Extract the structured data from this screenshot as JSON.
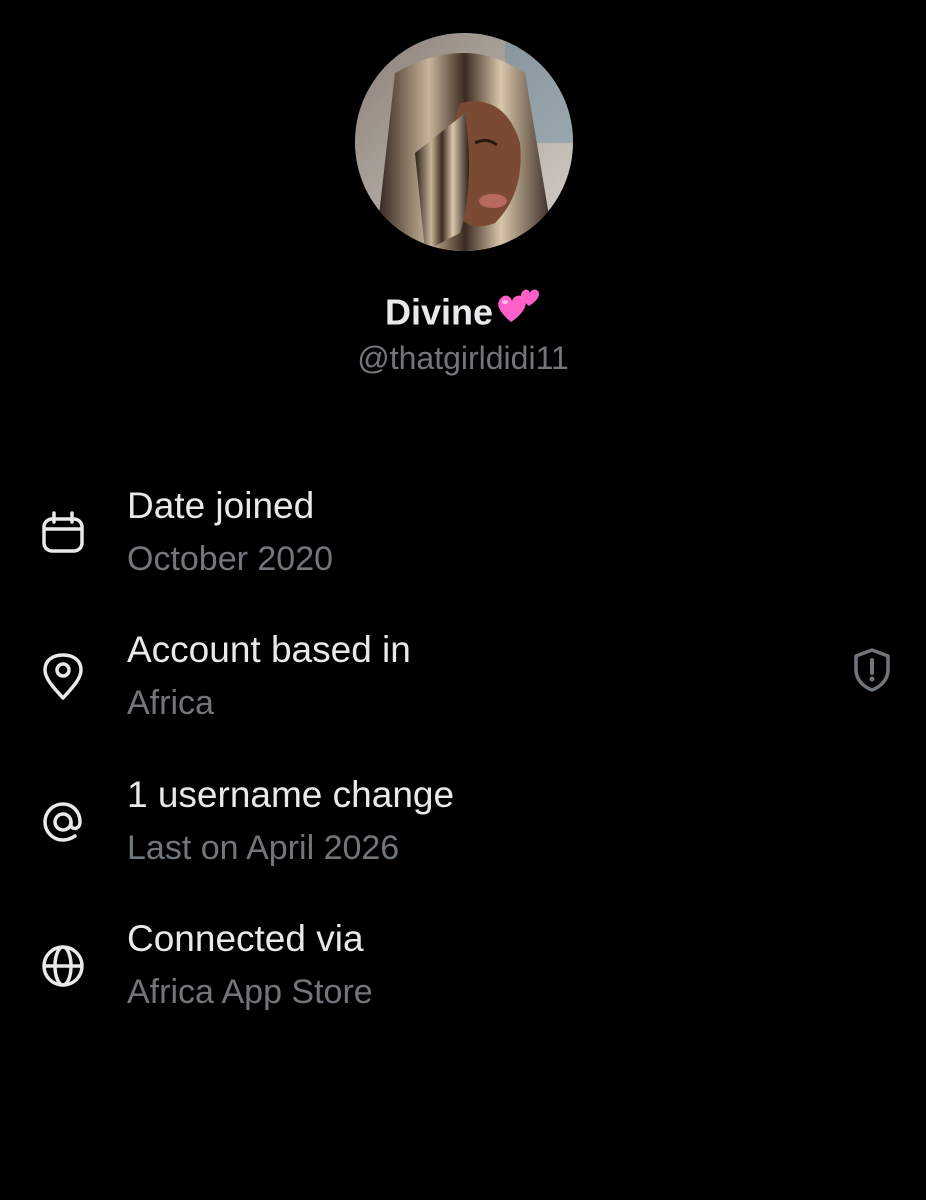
{
  "profile": {
    "display_name": "Divine",
    "name_emoji": "two-hearts-emoji",
    "handle": "@thatgirldidi11"
  },
  "details": [
    {
      "icon": "calendar-icon",
      "title": "Date joined",
      "value": "October 2020"
    },
    {
      "icon": "location-pin-icon",
      "title": "Account based in",
      "value": "Africa",
      "action_icon": "shield-alert-icon"
    },
    {
      "icon": "at-sign-icon",
      "title": "1 username change",
      "value": "Last on April 2026"
    },
    {
      "icon": "globe-icon",
      "title": "Connected via",
      "value": "Africa App Store"
    }
  ],
  "colors": {
    "background": "#000000",
    "primary_text": "#e7e9ea",
    "secondary_text": "#71767b",
    "heart": "#ff5fc8"
  }
}
